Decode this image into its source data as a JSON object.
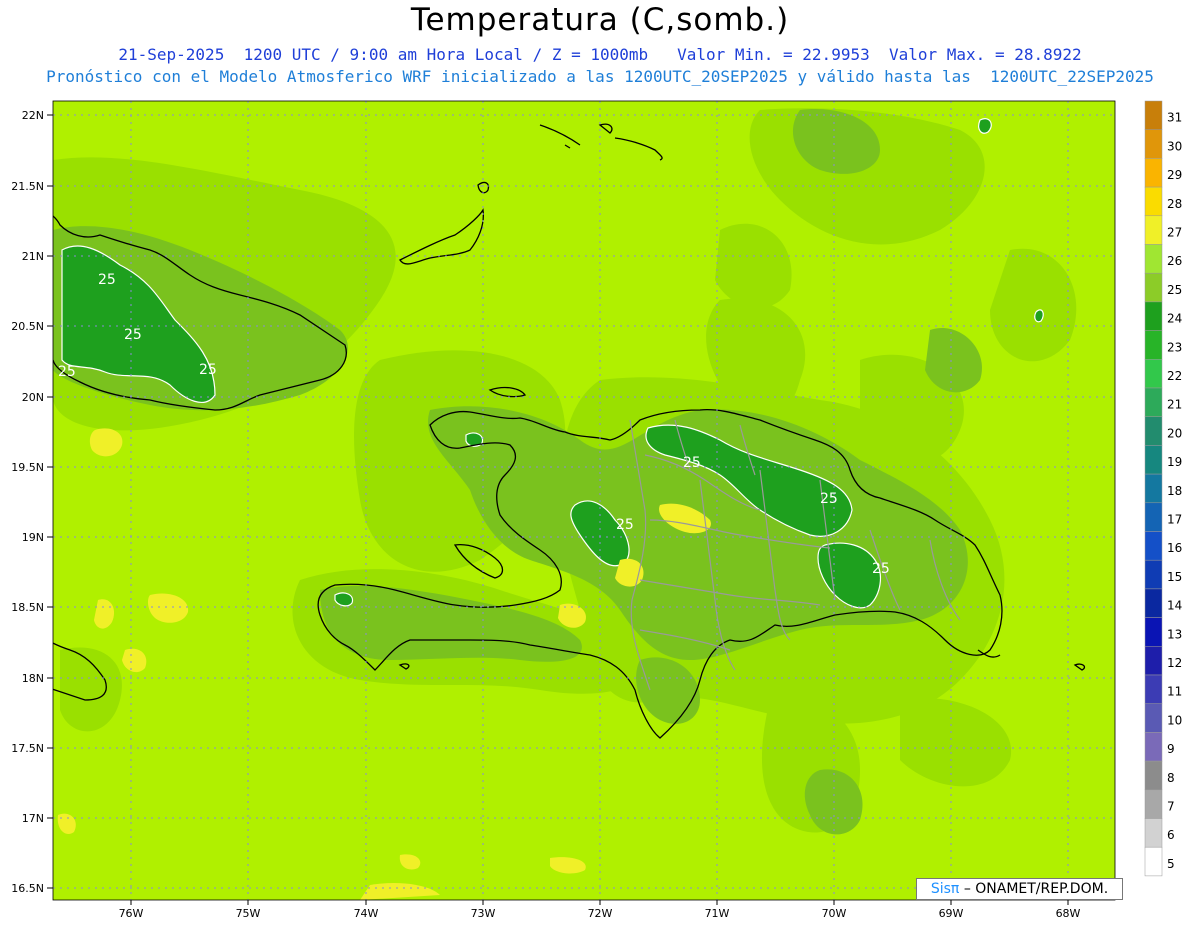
{
  "header": {
    "title": "Temperatura (C,somb.)",
    "line1": "21-Sep-2025  1200 UTC / 9:00 am Hora Local / Z = 1000mb   Valor Min. = 22.9953  Valor Max. = 28.8922",
    "line2": "Pronóstico con el Modelo Atmosferico WRF inicializado a las 1200UTC_20SEP2025 y válido hasta las  1200UTC_22SEP2025"
  },
  "lat_labels": [
    "22N",
    "21.5N",
    "21N",
    "20.5N",
    "20N",
    "19.5N",
    "19N",
    "18.5N",
    "18N",
    "17.5N",
    "17N",
    "16.5N"
  ],
  "lon_labels": [
    "76W",
    "75W",
    "74W",
    "73W",
    "72W",
    "71W",
    "70W",
    "69W",
    "68W"
  ],
  "contour_labels": [
    "25",
    "25",
    "25",
    "25",
    "25",
    "25",
    "25",
    "25"
  ],
  "colorbar": {
    "levels": [
      "31",
      "30",
      "29",
      "28",
      "27",
      "26",
      "25",
      "24",
      "23",
      "22",
      "21",
      "20",
      "19",
      "18",
      "17",
      "16",
      "15",
      "14",
      "13",
      "12",
      "11",
      "10",
      "9",
      "8",
      "7",
      "6",
      "5"
    ],
    "colors": [
      "#c87f0a",
      "#e0960a",
      "#fab400",
      "#fadc00",
      "#f0f028",
      "#a0e632",
      "#8ccc28",
      "#1ea01e",
      "#28b428",
      "#32c84b",
      "#2daa5a",
      "#228c6e",
      "#16877f",
      "#1478a0",
      "#1464b4",
      "#1450c8",
      "#0f3cb4",
      "#0a28a0",
      "#0a14b4",
      "#1e1eaa",
      "#3c3cb4",
      "#5a5ab4",
      "#7a6ab8",
      "#8c8c8c",
      "#a8a8a8",
      "#d2d2d2",
      "#ffffff"
    ]
  },
  "credit": {
    "sis": "Sisπ",
    "org": "– ONAMET/REP.DOM."
  },
  "colors": {
    "field_base": "#b0f000",
    "field_light": "#9ae000",
    "field_mid": "#7ac21e",
    "field_dark": "#1ea01e",
    "field_warm": "#f0f028",
    "field_hot": "#fadc00"
  }
}
